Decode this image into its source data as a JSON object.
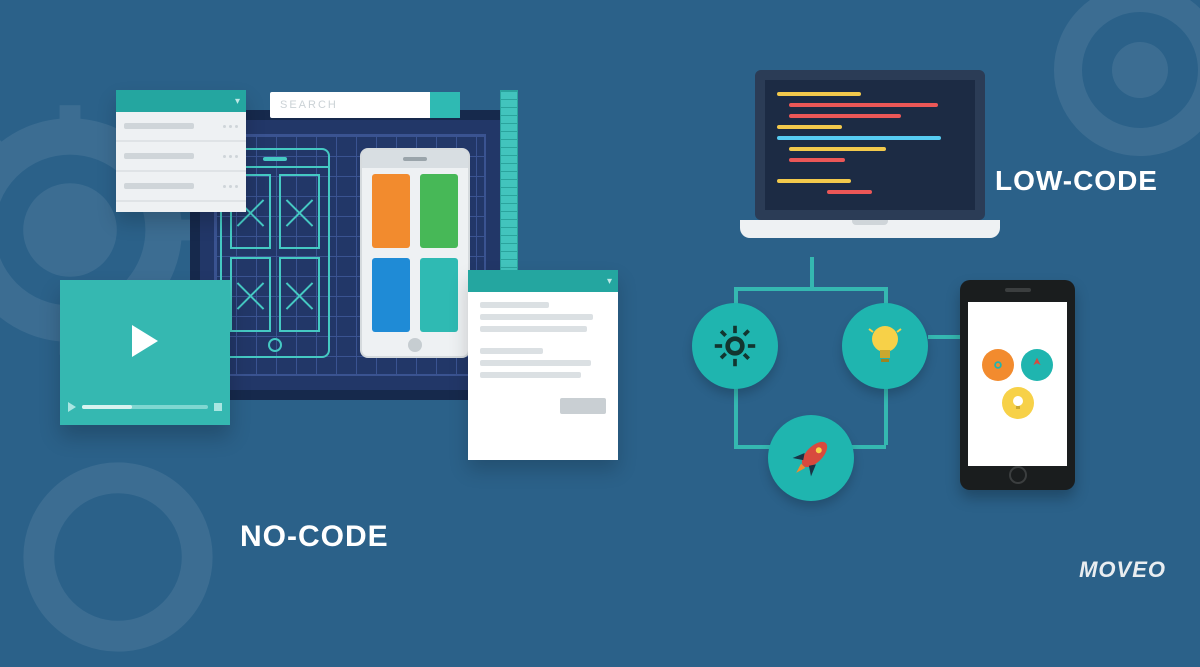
{
  "labels": {
    "nocode": "NO-CODE",
    "lowcode": "LOW-CODE",
    "search_placeholder": "SEARCH"
  },
  "brand": "MOVEO",
  "colors": {
    "bg": "#2b6189",
    "teal": "#24a6a0",
    "teal_light": "#35b8b1",
    "slab": "#223768",
    "app_orange": "#f28b2e",
    "app_green": "#47b857",
    "app_blue": "#1f8bd6",
    "app_teal": "#2fbab3",
    "code_yellow": "#f2c94c",
    "code_orange": "#eb5757",
    "code_blue": "#56ccf2",
    "rocket_red": "#d84a3e",
    "bulb_yellow": "#f7d148"
  },
  "icons": {
    "left_circle": "gear-icon",
    "right_circle": "lightbulb-icon",
    "bottom_circle": "rocket-icon",
    "phone_icons": [
      "gear-icon",
      "rocket-icon",
      "lightbulb-icon"
    ]
  }
}
